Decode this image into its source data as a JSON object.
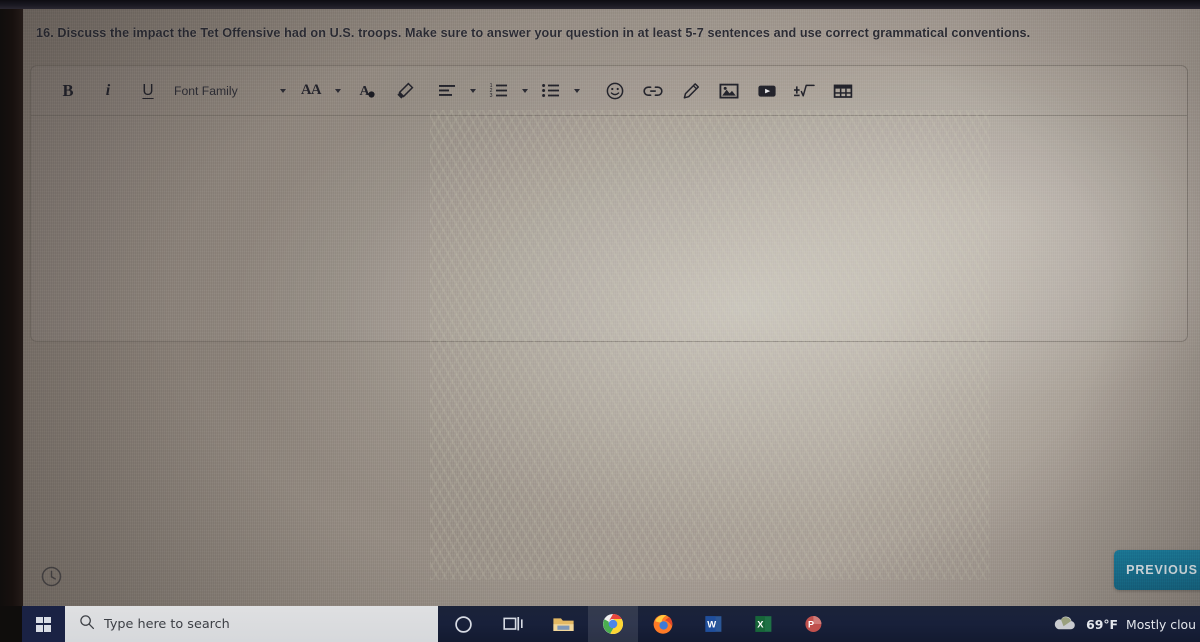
{
  "question": {
    "text": "16. Discuss the impact the Tet Offensive had on U.S. troops. Make sure to answer your question in at least 5-7 sentences and use correct grammatical conventions."
  },
  "editor": {
    "toolbar": {
      "bold_label": "B",
      "italic_label": "i",
      "underline_label": "U",
      "font_family_label": "Font Family",
      "font_size_label": "AA",
      "items": [
        {
          "name": "bold-button",
          "label": "B"
        },
        {
          "name": "italic-button",
          "label": "i"
        },
        {
          "name": "underline-button",
          "label": "U"
        },
        {
          "name": "font-family-dropdown",
          "label": "Font Family"
        },
        {
          "name": "font-size-dropdown",
          "label": "AA"
        },
        {
          "name": "text-color-button",
          "label": "A"
        },
        {
          "name": "highlighter-button",
          "label": ""
        },
        {
          "name": "align-dropdown",
          "label": ""
        },
        {
          "name": "numbered-list-dropdown",
          "label": ""
        },
        {
          "name": "bullet-list-dropdown",
          "label": ""
        },
        {
          "name": "emoji-button",
          "label": ""
        },
        {
          "name": "link-button",
          "label": ""
        },
        {
          "name": "draw-button",
          "label": ""
        },
        {
          "name": "insert-image-button",
          "label": ""
        },
        {
          "name": "insert-video-button",
          "label": ""
        },
        {
          "name": "insert-equation-button",
          "label": ""
        },
        {
          "name": "insert-table-button",
          "label": ""
        }
      ]
    },
    "body_text": ""
  },
  "footer": {
    "previous_label": "PREVIOUS",
    "timer_icon": "clock-icon"
  },
  "taskbar": {
    "start_label": "",
    "search_placeholder": "Type here to search",
    "apps": [
      {
        "name": "cortana-icon",
        "label": ""
      },
      {
        "name": "task-view-icon",
        "label": ""
      },
      {
        "name": "file-explorer-icon",
        "label": ""
      },
      {
        "name": "chrome-icon",
        "label": ""
      },
      {
        "name": "firefox-icon",
        "label": ""
      },
      {
        "name": "word-icon",
        "label": "W"
      },
      {
        "name": "excel-icon",
        "label": "X"
      },
      {
        "name": "powerpoint-icon",
        "label": "P"
      }
    ],
    "weather_temp": "69°F",
    "weather_desc": "Mostly clou"
  },
  "colors": {
    "accent_button": "#1a7595",
    "taskbar": "#18203a",
    "screen_base": "#9b9289",
    "text_dark": "#2b2b33"
  }
}
